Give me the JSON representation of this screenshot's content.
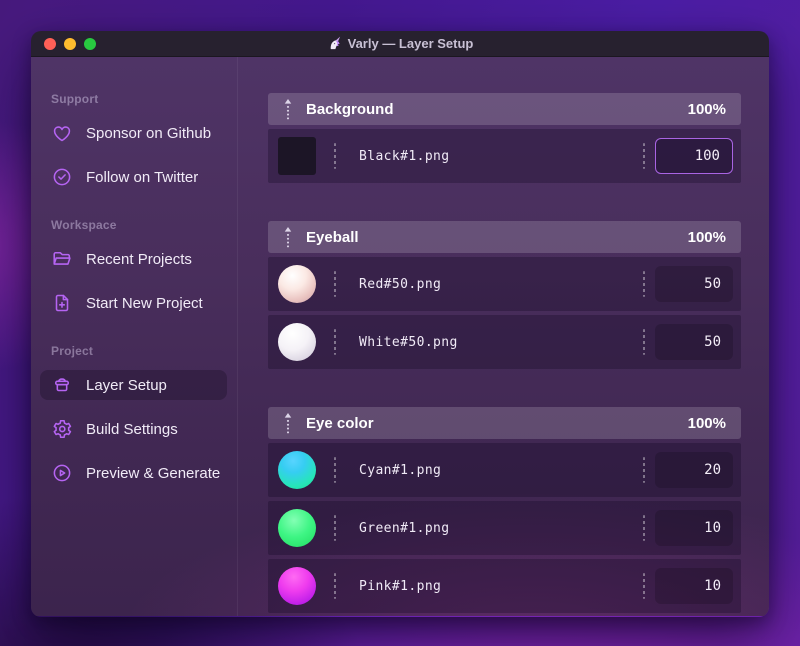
{
  "window": {
    "title": "Varly — Layer Setup",
    "app_icon": "unicorn-icon",
    "traffic_lights": {
      "close": "#ff5f57",
      "minimize": "#febc2e",
      "zoom": "#28c840"
    }
  },
  "colors": {
    "accent_icon": "#b564f2",
    "focused_input_border": "#a964e3",
    "wallpaper_purple": "#4b1da5",
    "wallpaper_magenta": "#c12fd0",
    "titlebar": "#27212f"
  },
  "sidebar": {
    "sections": [
      {
        "label": "Support",
        "items": [
          {
            "icon": "heart-icon",
            "label": "Sponsor on Github"
          },
          {
            "icon": "badge-check-icon",
            "label": "Follow on Twitter"
          }
        ]
      },
      {
        "label": "Workspace",
        "items": [
          {
            "icon": "folder-open-icon",
            "label": "Recent Projects"
          },
          {
            "icon": "file-plus-icon",
            "label": "Start New Project"
          }
        ]
      },
      {
        "label": "Project",
        "items": [
          {
            "icon": "layer-box-icon",
            "label": "Layer Setup",
            "active": true
          },
          {
            "icon": "gear-icon",
            "label": "Build Settings"
          },
          {
            "icon": "play-circle-icon",
            "label": "Preview & Generate"
          }
        ]
      }
    ]
  },
  "layers": {
    "groups": [
      {
        "name": "Background",
        "opacity": "100%",
        "rows": [
          {
            "thumb": "black-square",
            "file": "Black#1.png",
            "value": "100",
            "focused": true
          }
        ]
      },
      {
        "name": "Eyeball",
        "opacity": "100%",
        "rows": [
          {
            "thumb": "red-sphere",
            "file": "Red#50.png",
            "value": "50"
          },
          {
            "thumb": "white-sphere",
            "file": "White#50.png",
            "value": "50"
          }
        ]
      },
      {
        "name": "Eye color",
        "opacity": "100%",
        "rows": [
          {
            "thumb": "cyan-sphere",
            "file": "Cyan#1.png",
            "value": "20"
          },
          {
            "thumb": "green-sphere",
            "file": "Green#1.png",
            "value": "10"
          },
          {
            "thumb": "pink-sphere",
            "file": "Pink#1.png",
            "value": "10"
          }
        ]
      }
    ]
  }
}
